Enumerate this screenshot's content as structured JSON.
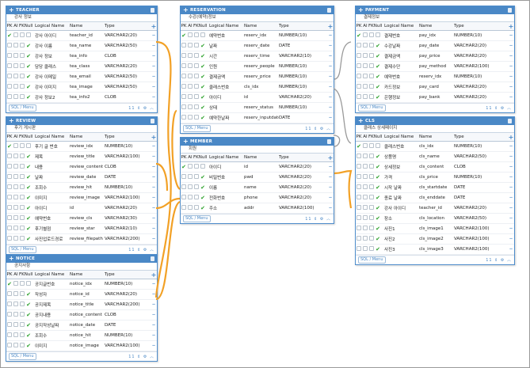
{
  "colors": {
    "header": "#4a88c6",
    "link": "#f2a126",
    "check": "#2ba12b"
  },
  "column_headers": {
    "pk": "PK",
    "ai": "AI",
    "fk": "FK",
    "null": "Null",
    "fknull": "FKNull",
    "logical": "Logical Name",
    "name": "Name",
    "type": "Type"
  },
  "footer": {
    "sql_label": "SQL / Menu",
    "icons": "11 ⇕ ⚙ ︿"
  },
  "tables": [
    {
      "id": "teacher",
      "title": "TEACHER",
      "comment": "강사 정보",
      "rows": [
        {
          "pk": true,
          "nn": false,
          "logical": "강사 아이디",
          "name": "teacher_id",
          "type": "VARCHAR2(20)"
        },
        {
          "pk": false,
          "nn": true,
          "logical": "강사 이름",
          "name": "tea_name",
          "type": "VARCHAR2(50)"
        },
        {
          "pk": false,
          "nn": true,
          "logical": "강사 정보",
          "name": "tea_info",
          "type": "CLOB"
        },
        {
          "pk": false,
          "nn": true,
          "logical": "담당 클래스",
          "name": "tea_class",
          "type": "VARCHAR2(20)"
        },
        {
          "pk": false,
          "nn": true,
          "logical": "강사 이메일",
          "name": "tea_email",
          "type": "VARCHAR2(50)"
        },
        {
          "pk": false,
          "nn": true,
          "logical": "강사 이미지",
          "name": "tea_image",
          "type": "VARCHAR2(50)"
        },
        {
          "pk": false,
          "nn": true,
          "logical": "강사 정보2",
          "name": "tea_info2",
          "type": "CLOB"
        }
      ]
    },
    {
      "id": "review",
      "title": "REVIEW",
      "comment": "후기 게시판",
      "rows": [
        {
          "pk": true,
          "nn": false,
          "logical": "후기 글 번호",
          "name": "review_idx",
          "type": "NUMBER(10)"
        },
        {
          "pk": false,
          "nn": true,
          "logical": "제목",
          "name": "review_title",
          "type": "VARCHAR2(100)"
        },
        {
          "pk": false,
          "nn": true,
          "logical": "내용",
          "name": "review_content",
          "type": "CLOB"
        },
        {
          "pk": false,
          "nn": true,
          "logical": "날짜",
          "name": "review_date",
          "type": "DATE"
        },
        {
          "pk": false,
          "nn": true,
          "logical": "조회수",
          "name": "review_hit",
          "type": "NUMBER(10)"
        },
        {
          "pk": false,
          "nn": true,
          "logical": "이미지",
          "name": "review_image",
          "type": "VARCHAR2(100)"
        },
        {
          "pk": false,
          "nn": true,
          "logical": "아이디",
          "name": "id",
          "type": "VARCHAR2(20)"
        },
        {
          "pk": false,
          "nn": true,
          "logical": "예약번호",
          "name": "review_cls",
          "type": "VARCHAR2(30)"
        },
        {
          "pk": false,
          "nn": true,
          "logical": "후기별점",
          "name": "review_star",
          "type": "VARCHAR2(10)"
        },
        {
          "pk": false,
          "nn": true,
          "logical": "사진업로드경로",
          "name": "review_filepath",
          "type": "VARCHAR2(200)"
        }
      ]
    },
    {
      "id": "notice",
      "title": "NOTICE",
      "comment": "공지사항",
      "rows": [
        {
          "pk": true,
          "nn": false,
          "logical": "공지글번호",
          "name": "notice_idx",
          "type": "NUMBER(10)"
        },
        {
          "pk": false,
          "nn": true,
          "logical": "작성자",
          "name": "notice_id",
          "type": "VARCHAR2(20)"
        },
        {
          "pk": false,
          "nn": true,
          "logical": "공지제목",
          "name": "notice_title",
          "type": "VARCHAR2(200)"
        },
        {
          "pk": false,
          "nn": true,
          "logical": "공지내용",
          "name": "notice_content",
          "type": "CLOB"
        },
        {
          "pk": false,
          "nn": true,
          "logical": "공지작성날짜",
          "name": "notice_date",
          "type": "DATE"
        },
        {
          "pk": false,
          "nn": true,
          "logical": "조회수",
          "name": "notice_hit",
          "type": "NUMBER(10)"
        },
        {
          "pk": false,
          "nn": true,
          "logical": "이미지",
          "name": "notice_image",
          "type": "VARCHAR2(100)"
        }
      ]
    },
    {
      "id": "reservation",
      "title": "RESERVATION",
      "comment": "수강(예약)정보",
      "rows": [
        {
          "pk": true,
          "nn": false,
          "logical": "예약번호",
          "name": "reserv_idx",
          "type": "NUMBER(10)"
        },
        {
          "pk": false,
          "nn": true,
          "logical": "날짜",
          "name": "reserv_date",
          "type": "DATE"
        },
        {
          "pk": false,
          "nn": true,
          "logical": "시간",
          "name": "reserv_time",
          "type": "VARCHAR2(10)"
        },
        {
          "pk": false,
          "nn": true,
          "logical": "인원",
          "name": "reserv_people",
          "type": "NUMBER(10)"
        },
        {
          "pk": false,
          "nn": true,
          "logical": "결제금액",
          "name": "reserv_price",
          "type": "NUMBER(10)"
        },
        {
          "pk": false,
          "nn": true,
          "logical": "클래스번호",
          "name": "cls_idx",
          "type": "NUMBER(10)"
        },
        {
          "pk": false,
          "nn": true,
          "logical": "아이디",
          "name": "id",
          "type": "VARCHAR2(20)"
        },
        {
          "pk": false,
          "nn": true,
          "logical": "상태",
          "name": "reserv_status",
          "type": "NUMBER(10)"
        },
        {
          "pk": false,
          "nn": true,
          "logical": "예약한날짜",
          "name": "reserv_inputdate",
          "type": "DATE"
        }
      ]
    },
    {
      "id": "member",
      "title": "MEMBER",
      "comment": "회원",
      "rows": [
        {
          "pk": true,
          "nn": false,
          "logical": "아이디",
          "name": "id",
          "type": "VARCHAR2(20)"
        },
        {
          "pk": false,
          "nn": true,
          "logical": "비밀번호",
          "name": "pwd",
          "type": "VARCHAR2(20)"
        },
        {
          "pk": false,
          "nn": true,
          "logical": "이름",
          "name": "name",
          "type": "VARCHAR2(20)"
        },
        {
          "pk": false,
          "nn": true,
          "logical": "전화번호",
          "name": "phone",
          "type": "VARCHAR2(20)"
        },
        {
          "pk": false,
          "nn": true,
          "logical": "주소",
          "name": "addr",
          "type": "VARCHAR2(100)"
        }
      ]
    },
    {
      "id": "payment",
      "title": "PAYMENT",
      "comment": "결제정보",
      "rows": [
        {
          "pk": true,
          "nn": false,
          "logical": "결제번호",
          "name": "pay_idx",
          "type": "NUMBER(10)"
        },
        {
          "pk": false,
          "nn": true,
          "logical": "수강날짜",
          "name": "pay_date",
          "type": "VARCHAR2(20)"
        },
        {
          "pk": false,
          "nn": true,
          "logical": "결제금액",
          "name": "pay_price",
          "type": "VARCHAR2(20)"
        },
        {
          "pk": false,
          "nn": true,
          "logical": "결제수단",
          "name": "pay_method",
          "type": "VARCHAR2(100)"
        },
        {
          "pk": false,
          "nn": true,
          "logical": "예약번호",
          "name": "reserv_idx",
          "type": "NUMBER(10)"
        },
        {
          "pk": false,
          "nn": true,
          "logical": "카드정보",
          "name": "pay_card",
          "type": "VARCHAR2(20)"
        },
        {
          "pk": false,
          "nn": true,
          "logical": "은행정보",
          "name": "pay_bank",
          "type": "VARCHAR2(20)"
        }
      ]
    },
    {
      "id": "cls",
      "title": "CLS",
      "comment": "클래스 상세페이지",
      "rows": [
        {
          "pk": true,
          "nn": false,
          "logical": "클래스번호",
          "name": "cls_idx",
          "type": "NUMBER(10)"
        },
        {
          "pk": false,
          "nn": true,
          "logical": "상품명",
          "name": "cls_name",
          "type": "VARCHAR2(50)"
        },
        {
          "pk": false,
          "nn": true,
          "logical": "상세정보",
          "name": "cls_content",
          "type": "CLOB"
        },
        {
          "pk": false,
          "nn": true,
          "logical": "가격",
          "name": "cls_price",
          "type": "NUMBER(10)"
        },
        {
          "pk": false,
          "nn": true,
          "logical": "시작 날짜",
          "name": "cls_startdate",
          "type": "DATE"
        },
        {
          "pk": false,
          "nn": true,
          "logical": "종료 날짜",
          "name": "cls_enddate",
          "type": "DATE"
        },
        {
          "pk": false,
          "nn": true,
          "logical": "강사 아이디",
          "name": "teacher_id",
          "type": "VARCHAR2(20)"
        },
        {
          "pk": false,
          "nn": true,
          "logical": "장소",
          "name": "cls_location",
          "type": "VARCHAR2(50)"
        },
        {
          "pk": false,
          "nn": true,
          "logical": "사진1",
          "name": "cls_image1",
          "type": "VARCHAR2(100)"
        },
        {
          "pk": false,
          "nn": true,
          "logical": "사진2",
          "name": "cls_image2",
          "type": "VARCHAR2(100)"
        },
        {
          "pk": false,
          "nn": true,
          "logical": "사진3",
          "name": "cls_image3",
          "type": "VARCHAR2(100)"
        }
      ]
    }
  ]
}
